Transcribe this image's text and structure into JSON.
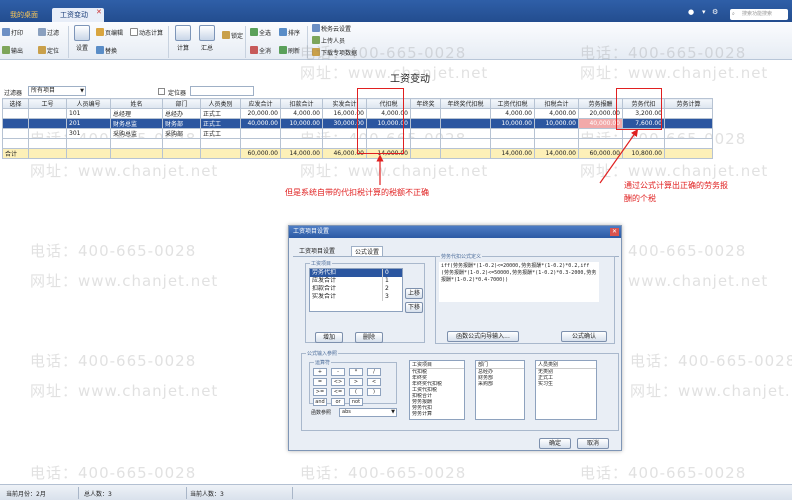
{
  "titlebar": {
    "tabs": [
      {
        "label": "我的桌面"
      },
      {
        "label": "工资变动"
      }
    ],
    "search_placeholder": "搜索功能搜索"
  },
  "ribbon": {
    "print": "打印",
    "output": "输出",
    "filter": "过滤",
    "locate": "定位",
    "settings": "设置",
    "page_edit": "页编辑",
    "dynamic_calc": "动态计算",
    "replace": "替换",
    "calculate": "计算",
    "summary": "汇总",
    "lock": "锁定",
    "select_all": "全选",
    "deselect_all": "全消",
    "sort": "排序",
    "refresh": "刷新",
    "tax_cloud": "税务云设置",
    "upload_person": "上传人员",
    "download_items": "下载专项数据"
  },
  "page": {
    "title": "工资变动",
    "filter_label": "过滤器",
    "filter_value": "所有项目",
    "locator_label": "定位器"
  },
  "grid": {
    "columns": [
      "选择",
      "工号",
      "人员编号",
      "姓名",
      "部门",
      "人员类别",
      "应发合计",
      "扣款合计",
      "实发合计",
      "代扣税",
      "年终奖",
      "年终奖代扣税",
      "工资代扣税",
      "扣税合计",
      "劳务报酬",
      "劳务代扣",
      "劳务计算"
    ],
    "rows": [
      {
        "cells": [
          "",
          "",
          "101",
          "总经理",
          "总经办",
          "正式工",
          "20,000.00",
          "4,000.00",
          "16,000.00",
          "4,000.00",
          "",
          "",
          "4,000.00",
          "4,000.00",
          "20,000.00",
          "3,200.00",
          ""
        ],
        "selected": false
      },
      {
        "cells": [
          "",
          "",
          "201",
          "财务总监",
          "财务部",
          "正式工",
          "40,000.00",
          "10,000.00",
          "30,000.00",
          "10,000.00",
          "",
          "",
          "10,000.00",
          "10,000.00",
          "40,000.00",
          "7,600.00",
          ""
        ],
        "selected": true
      },
      {
        "cells": [
          "",
          "",
          "301",
          "采购总监",
          "采购部",
          "正式工",
          "",
          "",
          "",
          "",
          "",
          "",
          "",
          "",
          "",
          "",
          ""
        ],
        "selected": false
      }
    ],
    "total": [
      "合计",
      "",
      "",
      "",
      "",
      "",
      "60,000.00",
      "14,000.00",
      "46,000.00",
      "14,000.00",
      "",
      "",
      "14,000.00",
      "14,000.00",
      "60,000.00",
      "10,800.00",
      ""
    ]
  },
  "annotations": {
    "left": "但是系统自带的代扣税计算的税额不正确",
    "right_line1": "通过公式计算出正确的劳务报",
    "right_line2": "酬的个税"
  },
  "dialog": {
    "title": "工资项目设置",
    "tabs": [
      "工资项目设置",
      "公式设置"
    ],
    "items_label": "工资项目",
    "items": [
      {
        "name": "劳务代扣",
        "value": "0"
      },
      {
        "name": "应发合计",
        "value": "1"
      },
      {
        "name": "扣款合计",
        "value": "2"
      },
      {
        "name": "实发合计",
        "value": "3"
      }
    ],
    "formula_label": "劳务代扣公式定义",
    "formula": "iff(劳务报酬*(1-0.2)<=20000,劳务报酬*(1-0.2)*0.2,iff(劳务报酬*(1-0.2)<=50000,劳务报酬*(1-0.2)*0.3-2000,劳务报酬*(1-0.2)*0.4-7000))",
    "move_up": "上移",
    "move_down": "下移",
    "add": "增加",
    "delete": "删除",
    "func_wizard": "函数公式向导输入...",
    "formula_confirm": "公式确认",
    "ref_label": "公式输入参照",
    "operators_label": "运算符",
    "operators": [
      "+",
      "-",
      "*",
      "/",
      "=",
      "<>",
      ">",
      "<",
      ">=",
      "<=",
      "(",
      ")",
      "and",
      "or",
      "not"
    ],
    "func_ref_label": "函数参照",
    "func_ref_value": "abs",
    "ref_items_label": "工资项目",
    "ref_items": [
      "代扣税",
      "年终奖",
      "年终奖代扣税",
      "工资代扣税",
      "扣税合计",
      "劳务报酬",
      "劳务代扣",
      "劳务计算"
    ],
    "dept_label": "部门",
    "depts": [
      "总经办",
      "财务部",
      "采购部"
    ],
    "category_label": "人员类别",
    "categories": [
      "无类别",
      "正式工",
      "实习生"
    ],
    "ok": "确定",
    "cancel": "取消"
  },
  "status": {
    "month": "当前月份：2月",
    "total_people": "总人数：3",
    "current_people": "当前人数：3"
  },
  "watermark": {
    "phone": "电话：400-665-0028",
    "site": "网址：www.chanjet.net"
  }
}
